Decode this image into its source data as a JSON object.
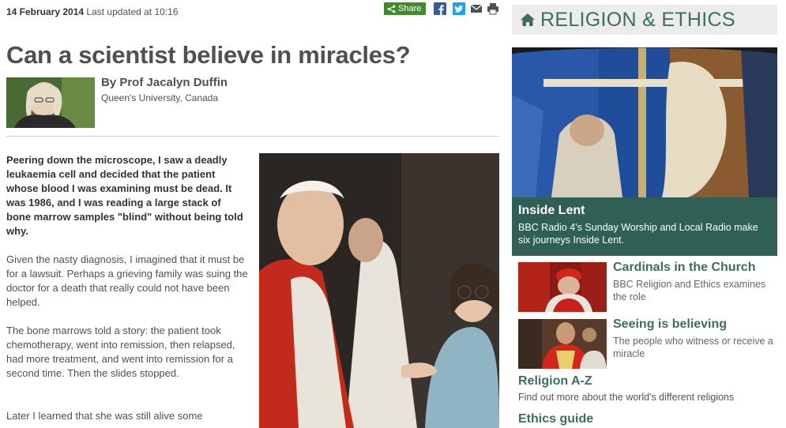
{
  "article": {
    "date": "14 February 2014",
    "updated": "Last updated at 10:16",
    "share_label": "Share",
    "headline": "Can a scientist believe in miracles?",
    "author": "By Prof Jacalyn Duffin",
    "affiliation": "Queen's University, Canada",
    "paragraphs": [
      "Peering down the microscope, I saw a deadly leukaemia cell and decided that the patient whose blood I was examining must be dead. It was 1986, and I was reading a large stack of bone marrow samples \"blind\" without being told why.",
      "Given the nasty diagnosis, I imagined that it must be for a lawsuit. Perhaps a grieving family was suing the doctor for a death that really could not have been helped.",
      "The bone marrows told a story: the patient took chemotherapy, went into remission, then relapsed, had more treatment, and went into remission for a second time. Then the slides stopped.",
      "Later I learned that she was still alive some"
    ]
  },
  "icons": {
    "share": "share-icon",
    "facebook": "facebook-icon",
    "twitter": "twitter-icon",
    "email": "email-icon",
    "print": "print-icon",
    "home": "home-icon"
  },
  "sidebar": {
    "heading": "RELIGION & ETHICS",
    "feature": {
      "title": "Inside Lent",
      "desc": "BBC Radio 4's Sunday Worship and Local Radio make six journeys Inside Lent."
    },
    "promos": [
      {
        "title": "Cardinals in the Church",
        "desc": "BBC Religion and Ethics examines the role"
      },
      {
        "title": "Seeing is believing",
        "desc": "The people who witness or receive a miracle"
      }
    ],
    "links": [
      {
        "title": "Religion A-Z",
        "desc": "Find out more about the world's different religions"
      },
      {
        "title": "Ethics guide"
      }
    ]
  },
  "colors": {
    "accent": "#3d6d62",
    "feature_bg": "#2f5f55",
    "share_green": "#3f8a2a",
    "facebook": "#3b5998",
    "twitter": "#1da1f2"
  }
}
